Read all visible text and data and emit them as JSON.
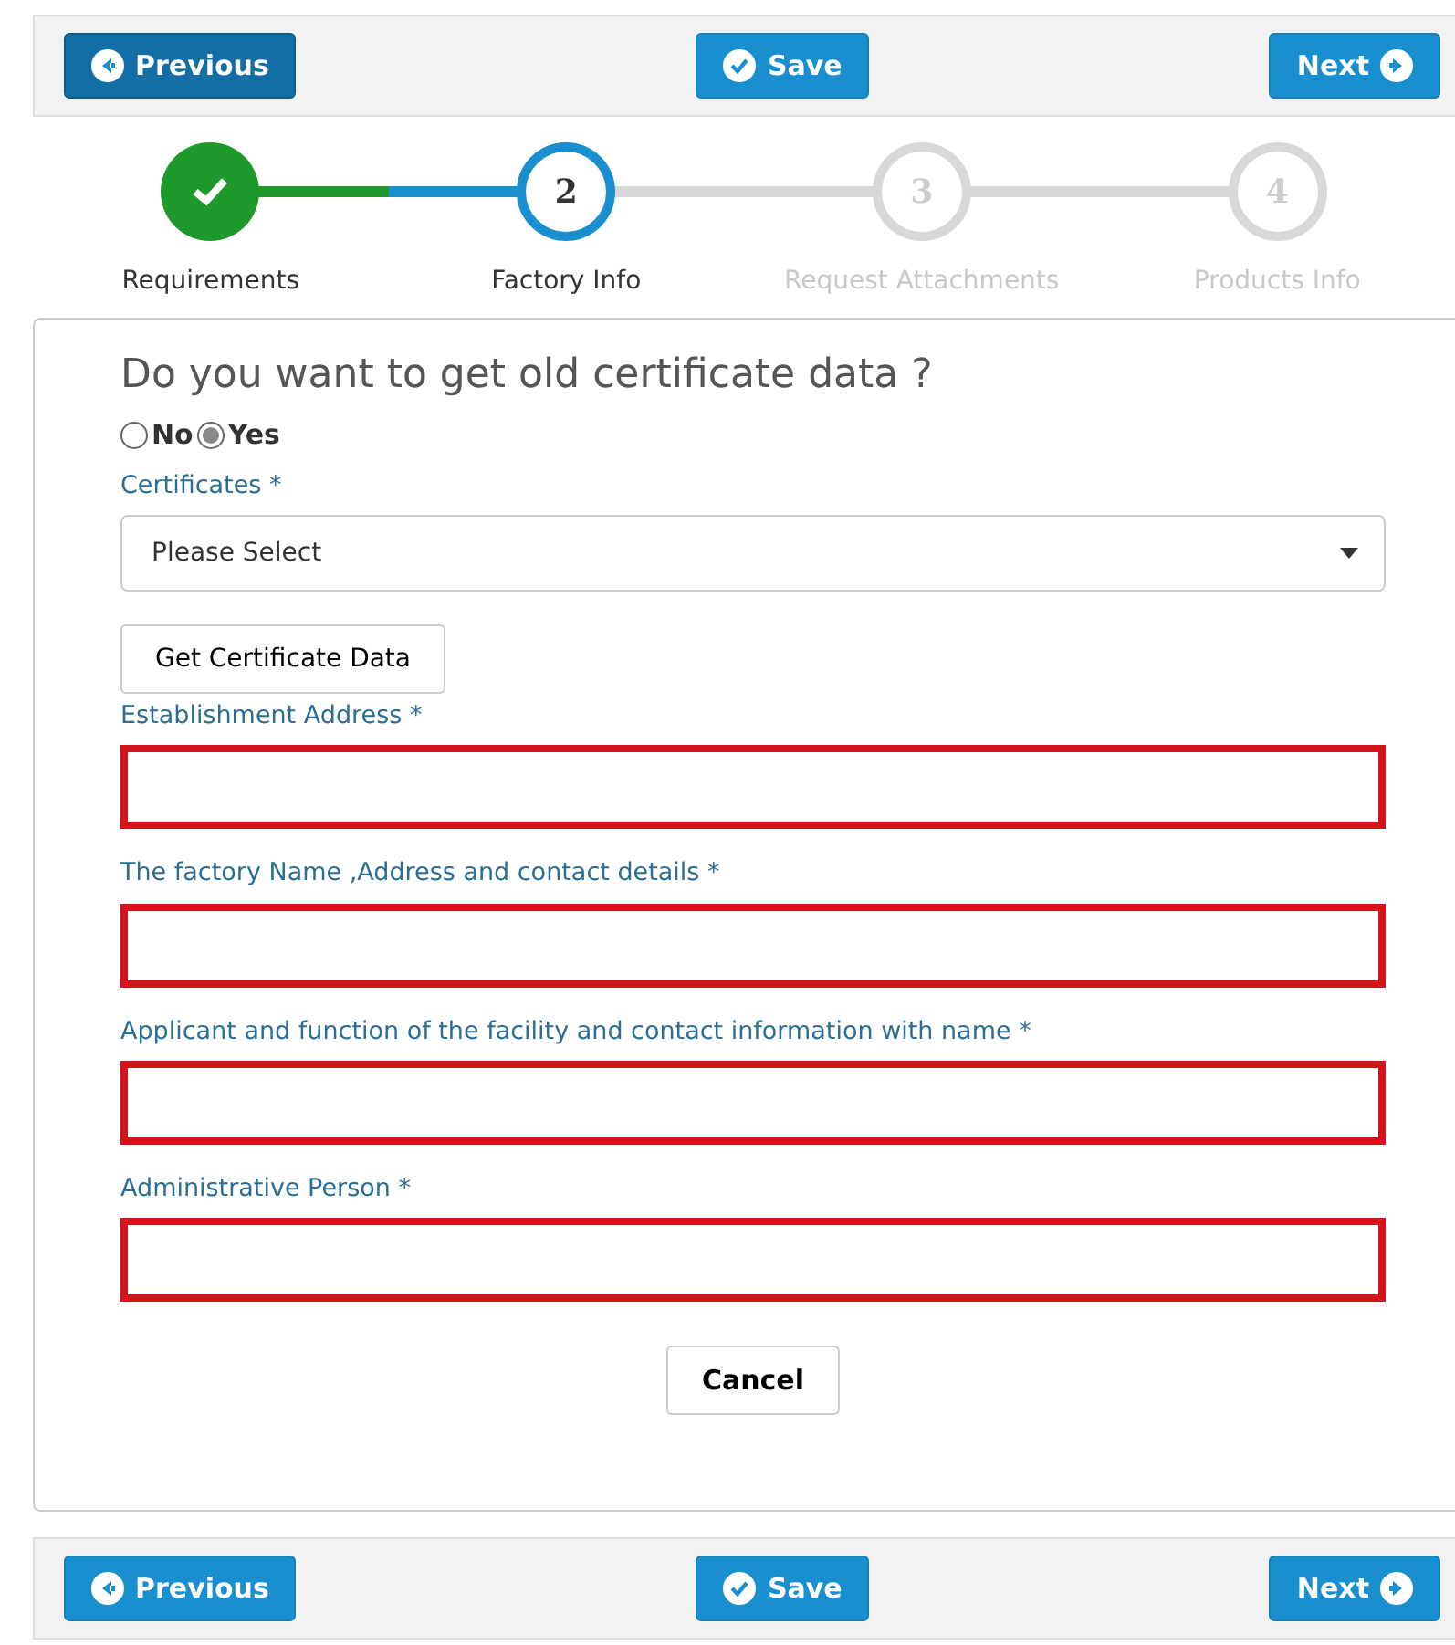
{
  "top_nav": [
    {
      "kind": "previous",
      "label": "Previous",
      "pressed": true
    },
    {
      "kind": "save",
      "label": "Save",
      "pressed": false
    },
    {
      "kind": "next",
      "label": "Next",
      "pressed": false
    }
  ],
  "steps": [
    {
      "label": "Requirements",
      "done": true,
      "current": false
    },
    {
      "number": "2",
      "label": "Factory Info",
      "done": false,
      "current": true
    },
    {
      "number": "3",
      "label": "Request Attachments",
      "done": false,
      "current": false
    },
    {
      "number": "4",
      "label": "Products Info",
      "done": false,
      "current": false
    }
  ],
  "form": {
    "question": "Do you want to get old certificate data ?",
    "options": [
      {
        "label": "No",
        "selected": false
      },
      {
        "label": "Yes",
        "selected": true
      }
    ],
    "certificates": {
      "label": "Certificates *",
      "placeholder": "Please Select"
    },
    "get_button": "Get Certificate Data",
    "fields": [
      {
        "label": "Establishment Address *",
        "invalid": true
      },
      {
        "label": "The factory Name ,Address and contact details *",
        "invalid": true
      },
      {
        "label": "Applicant and function of the facility and contact information with name *",
        "invalid": true
      },
      {
        "label": "Administrative Person *",
        "invalid": true
      }
    ],
    "cancel": "Cancel"
  },
  "bottom_nav": [
    {
      "kind": "previous",
      "label": "Previous",
      "pressed": false
    },
    {
      "kind": "save",
      "label": "Save",
      "pressed": false
    },
    {
      "kind": "next",
      "label": "Next",
      "pressed": false
    }
  ]
}
